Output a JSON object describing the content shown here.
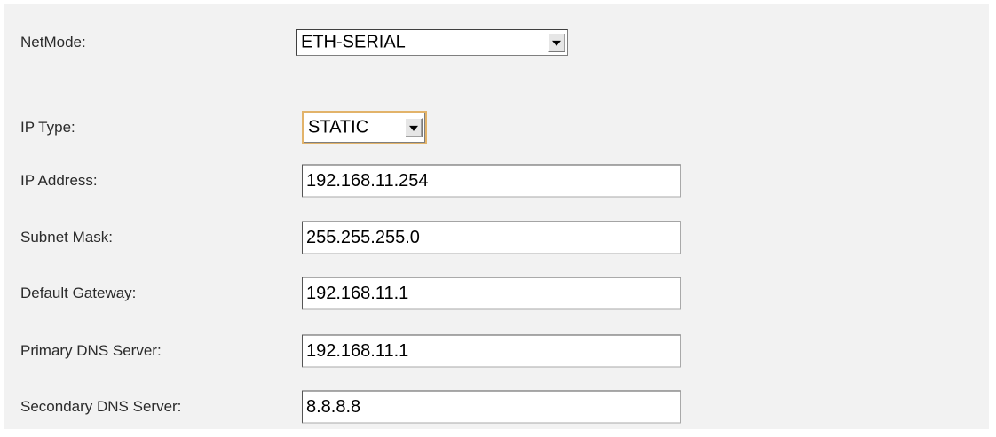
{
  "form": {
    "netmode": {
      "label": "NetMode:",
      "value": "ETH-SERIAL"
    },
    "ip_type": {
      "label": "IP Type:",
      "value": "STATIC"
    },
    "ip_address": {
      "label": "IP Address:",
      "value": "192.168.11.254"
    },
    "subnet_mask": {
      "label": "Subnet Mask:",
      "value": "255.255.255.0"
    },
    "default_gateway": {
      "label": "Default Gateway:",
      "value": "192.168.11.1"
    },
    "primary_dns": {
      "label": "Primary DNS Server:",
      "value": "192.168.11.1"
    },
    "secondary_dns": {
      "label": "Secondary DNS Server:",
      "value": "8.8.8.8"
    }
  },
  "colors": {
    "panel_background": "#f2f2f2",
    "focus_outline": "#e2b36a"
  },
  "icons": {
    "dropdown_arrow": "chevron-down-icon"
  }
}
